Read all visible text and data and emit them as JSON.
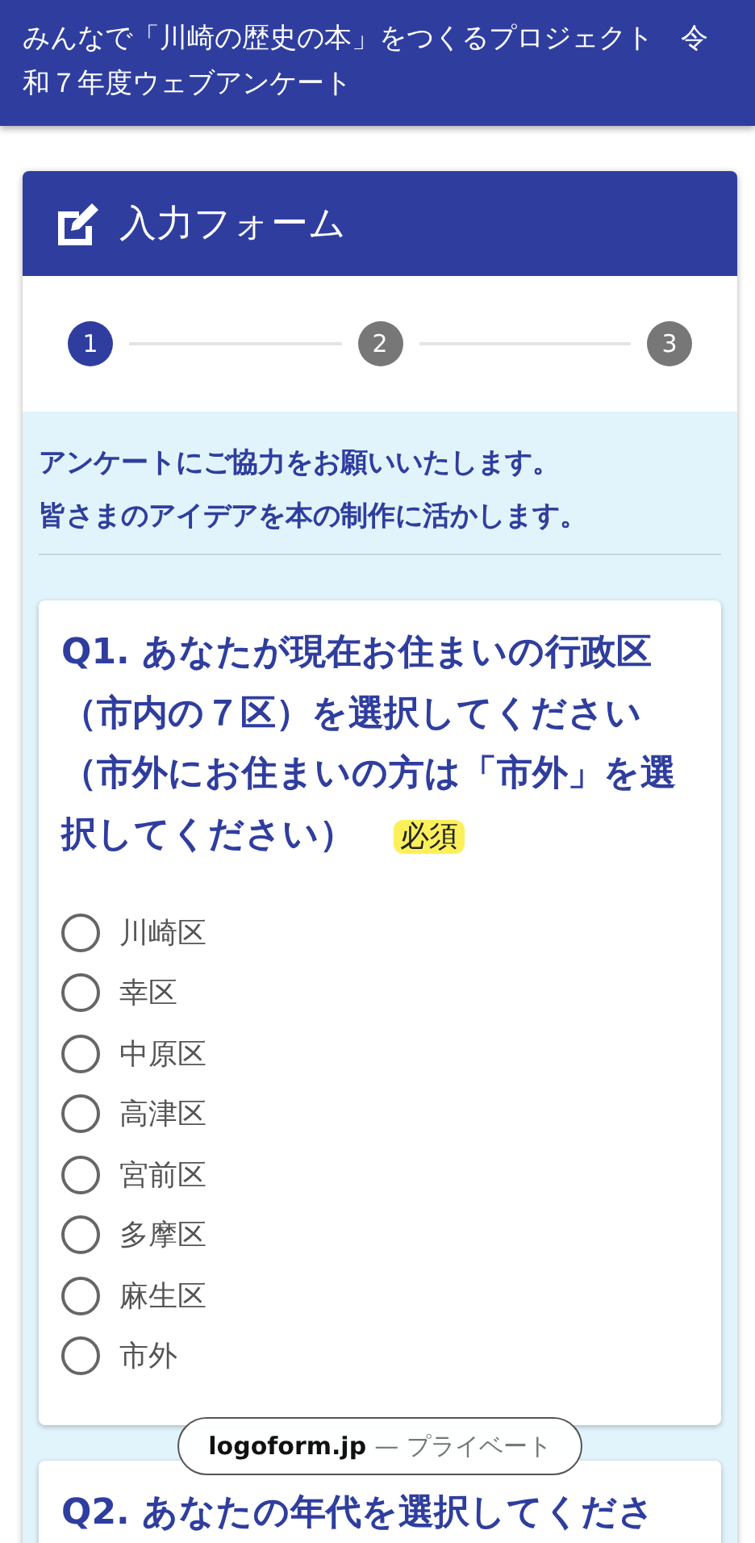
{
  "header": {
    "title": "みんなで「川崎の歴史の本」をつくるプロジェクト　令和７年度ウェブアンケート"
  },
  "form": {
    "title": "入力フォーム",
    "steps": [
      {
        "label": "1",
        "selected": true
      },
      {
        "label": "2",
        "selected": false
      },
      {
        "label": "3",
        "selected": false
      }
    ],
    "intro": [
      "アンケートにご協力をお願いいたします。",
      "皆さまのアイデアを本の制作に活かします。"
    ],
    "questions": [
      {
        "title": "Q1. あなたが現在お住まいの行政区（市内の７区）を選択してください（市外にお住まいの方は「市外」を選択してください）",
        "required_badge": "必須",
        "options": [
          {
            "label": "川崎区",
            "selected": false
          },
          {
            "label": "幸区",
            "selected": false
          },
          {
            "label": "中原区",
            "selected": false
          },
          {
            "label": "高津区",
            "selected": false
          },
          {
            "label": "宮前区",
            "selected": false
          },
          {
            "label": "多摩区",
            "selected": false
          },
          {
            "label": "麻生区",
            "selected": false
          },
          {
            "label": "市外",
            "selected": false
          }
        ]
      },
      {
        "title": "Q2. あなたの年代を選択してくださ"
      }
    ]
  },
  "address_pill": {
    "domain": "logoform.jp",
    "suffix": "— プライベート"
  }
}
